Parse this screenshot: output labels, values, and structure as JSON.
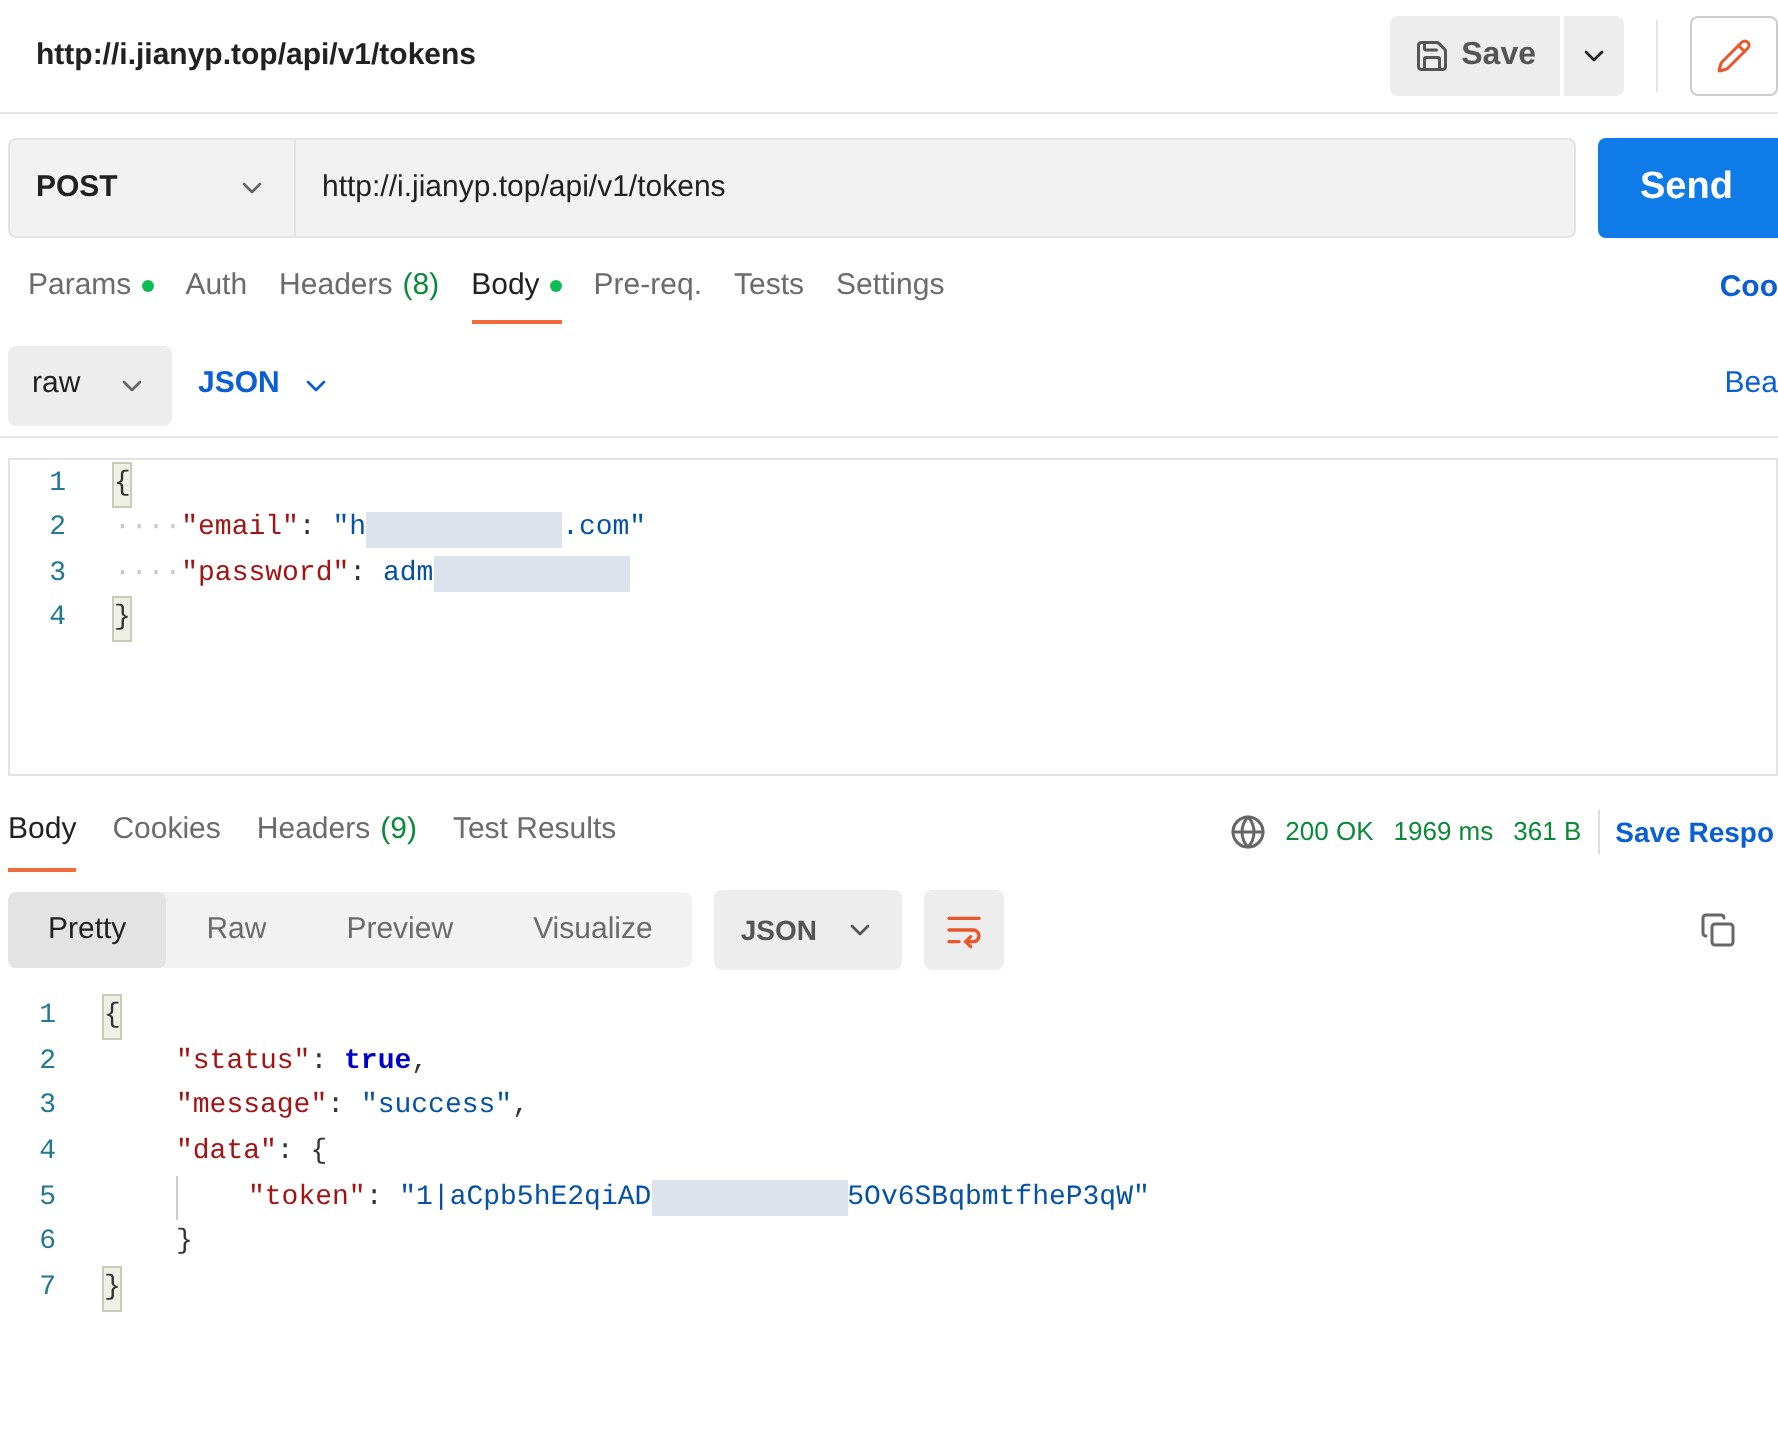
{
  "title": "http://i.jianyp.top/api/v1/tokens",
  "save_button": {
    "label": "Save"
  },
  "request": {
    "method": "POST",
    "url": "http://i.jianyp.top/api/v1/tokens",
    "send_label": "Send"
  },
  "request_tabs": [
    {
      "label": "Params",
      "dot": true,
      "selected": false
    },
    {
      "label": "Auth",
      "dot": false,
      "selected": false
    },
    {
      "label": "Headers",
      "count": "(8)",
      "dot": false,
      "selected": false
    },
    {
      "label": "Body",
      "dot": true,
      "selected": true
    },
    {
      "label": "Pre-req.",
      "dot": false,
      "selected": false
    },
    {
      "label": "Tests",
      "dot": false,
      "selected": false
    },
    {
      "label": "Settings",
      "dot": false,
      "selected": false
    }
  ],
  "request_tabs_right_link": "Coo",
  "body_mode": "raw",
  "body_format": "JSON",
  "beautify_link": "Bea",
  "request_body": [
    {
      "number": "1",
      "tokens": [
        {
          "kind": "brace",
          "text": "{"
        }
      ]
    },
    {
      "number": "2",
      "tokens": [
        {
          "kind": "ws",
          "text": "····"
        },
        {
          "kind": "key",
          "text": "\"email\""
        },
        {
          "kind": "punct",
          "text": ": "
        },
        {
          "kind": "string",
          "text": "\"h"
        },
        {
          "kind": "redacted"
        },
        {
          "kind": "string",
          "text": ".com\""
        }
      ]
    },
    {
      "number": "3",
      "tokens": [
        {
          "kind": "ws",
          "text": "····"
        },
        {
          "kind": "key",
          "text": "\"password\""
        },
        {
          "kind": "punct",
          "text": ": "
        },
        {
          "kind": "string",
          "text": "adm"
        },
        {
          "kind": "redacted"
        }
      ]
    },
    {
      "number": "4",
      "tokens": [
        {
          "kind": "brace",
          "text": "}"
        }
      ]
    }
  ],
  "response_tabs": [
    {
      "label": "Body",
      "selected": true
    },
    {
      "label": "Cookies",
      "selected": false
    },
    {
      "label": "Headers",
      "count": "(9)",
      "selected": false
    },
    {
      "label": "Test Results",
      "selected": false
    }
  ],
  "response_status": {
    "code": "200 OK",
    "time": "1969 ms",
    "size": "361 B",
    "save_link": "Save Respo"
  },
  "view_modes": [
    {
      "label": "Pretty",
      "selected": true
    },
    {
      "label": "Raw",
      "selected": false
    },
    {
      "label": "Preview",
      "selected": false
    },
    {
      "label": "Visualize",
      "selected": false
    }
  ],
  "response_format": "JSON",
  "response_body": [
    {
      "number": "1",
      "tokens": [
        {
          "kind": "brace",
          "text": "{"
        }
      ]
    },
    {
      "number": "2",
      "tokens": [
        {
          "kind": "indent"
        },
        {
          "kind": "key",
          "text": "\"status\""
        },
        {
          "kind": "punct",
          "text": ": "
        },
        {
          "kind": "bool",
          "text": "true"
        },
        {
          "kind": "punct",
          "text": ","
        }
      ]
    },
    {
      "number": "3",
      "tokens": [
        {
          "kind": "indent"
        },
        {
          "kind": "key",
          "text": "\"message\""
        },
        {
          "kind": "punct",
          "text": ": "
        },
        {
          "kind": "string",
          "text": "\"success\""
        },
        {
          "kind": "punct",
          "text": ","
        }
      ]
    },
    {
      "number": "4",
      "tokens": [
        {
          "kind": "indent"
        },
        {
          "kind": "key",
          "text": "\"data\""
        },
        {
          "kind": "punct",
          "text": ": "
        },
        {
          "kind": "punct",
          "text": "{"
        }
      ]
    },
    {
      "number": "5",
      "tokens": [
        {
          "kind": "indent"
        },
        {
          "kind": "guide"
        },
        {
          "kind": "key",
          "text": "\"token\""
        },
        {
          "kind": "punct",
          "text": ": "
        },
        {
          "kind": "string",
          "text": "\"1|aCpb5hE2qiAD"
        },
        {
          "kind": "redacted"
        },
        {
          "kind": "string",
          "text": "5Ov6SBqbmtfheP3qW\""
        }
      ]
    },
    {
      "number": "6",
      "tokens": [
        {
          "kind": "indent"
        },
        {
          "kind": "punct",
          "text": "}"
        }
      ]
    },
    {
      "number": "7",
      "tokens": [
        {
          "kind": "brace",
          "text": "}"
        }
      ]
    }
  ]
}
